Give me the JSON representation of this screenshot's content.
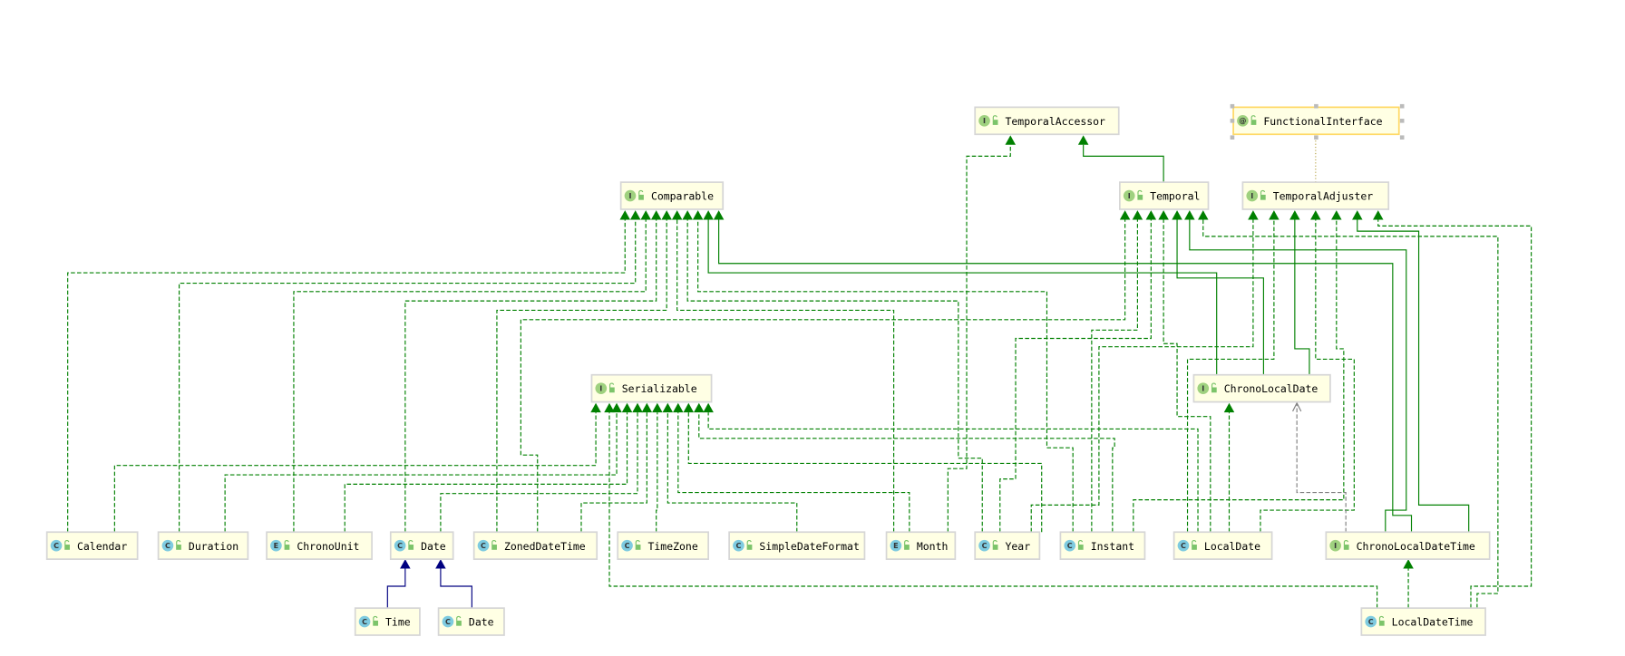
{
  "diagram": {
    "colors": {
      "realization": "#008000",
      "inheritance_class": "#000080",
      "dependency": "#808080",
      "annotation_link": "#b4a040",
      "node_fill": "#ffffe4",
      "node_border": "#d6d6d6",
      "selected_border": "#ffd966",
      "interface_icon": "#9fd17f",
      "class_icon": "#7ecbe0"
    },
    "nodes": {
      "temporal_accessor": {
        "label": "TemporalAccessor",
        "kind": "interface",
        "icon": "I"
      },
      "functional_interface": {
        "label": "FunctionalInterface",
        "kind": "annotation",
        "icon": "@",
        "selected": true
      },
      "comparable": {
        "label": "Comparable",
        "kind": "interface",
        "icon": "I"
      },
      "temporal": {
        "label": "Temporal",
        "kind": "interface",
        "icon": "I"
      },
      "temporal_adjuster": {
        "label": "TemporalAdjuster",
        "kind": "interface",
        "icon": "I"
      },
      "serializable": {
        "label": "Serializable",
        "kind": "interface",
        "icon": "I"
      },
      "chrono_local_date": {
        "label": "ChronoLocalDate",
        "kind": "interface",
        "icon": "I"
      },
      "calendar": {
        "label": "Calendar",
        "kind": "abstract-class",
        "icon": "C"
      },
      "duration": {
        "label": "Duration",
        "kind": "final-class",
        "icon": "C"
      },
      "chrono_unit": {
        "label": "ChronoUnit",
        "kind": "enum",
        "icon": "E"
      },
      "date": {
        "label": "Date",
        "kind": "class",
        "icon": "C"
      },
      "zoned_date_time": {
        "label": "ZonedDateTime",
        "kind": "final-class",
        "icon": "C"
      },
      "time_zone": {
        "label": "TimeZone",
        "kind": "abstract-class",
        "icon": "C"
      },
      "simple_date_format": {
        "label": "SimpleDateFormat",
        "kind": "class",
        "icon": "C"
      },
      "month": {
        "label": "Month",
        "kind": "enum",
        "icon": "E"
      },
      "year": {
        "label": "Year",
        "kind": "final-class",
        "icon": "C"
      },
      "instant": {
        "label": "Instant",
        "kind": "final-class",
        "icon": "C"
      },
      "local_date": {
        "label": "LocalDate",
        "kind": "final-class",
        "icon": "C"
      },
      "chrono_local_date_time": {
        "label": "ChronoLocalDateTime",
        "kind": "interface",
        "icon": "I"
      },
      "sql_time": {
        "label": "Time",
        "kind": "class",
        "icon": "C"
      },
      "sql_date": {
        "label": "Date",
        "kind": "class",
        "icon": "C"
      },
      "local_date_time": {
        "label": "LocalDateTime",
        "kind": "final-class",
        "icon": "C"
      }
    }
  }
}
